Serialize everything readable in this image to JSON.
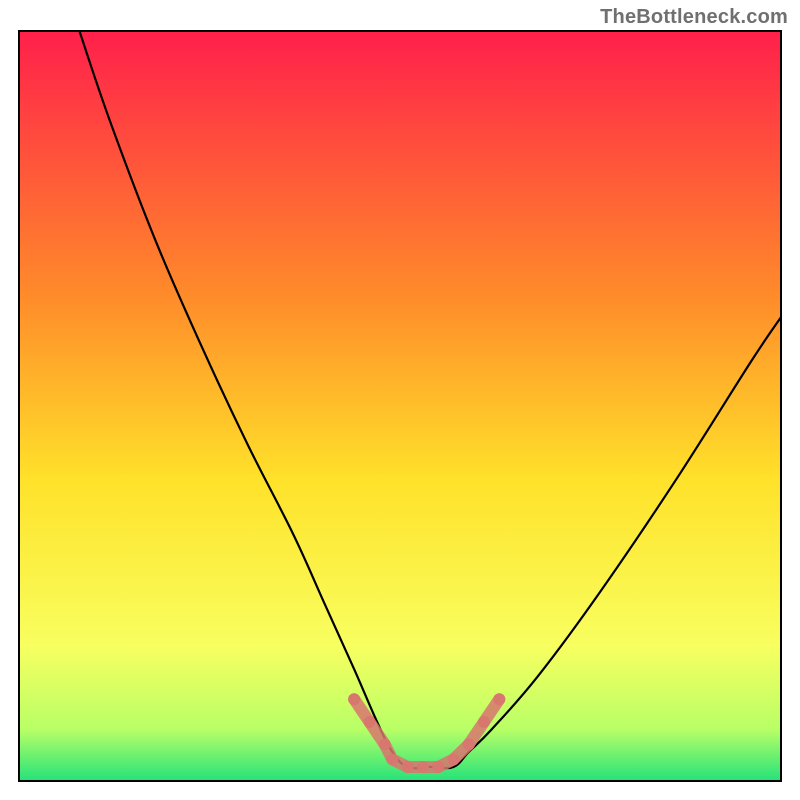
{
  "watermark": "TheBottleneck.com",
  "chart_data": {
    "type": "line",
    "title": "",
    "xlabel": "",
    "ylabel": "",
    "xlim": [
      0,
      100
    ],
    "ylim": [
      0,
      100
    ],
    "grid": false,
    "legend": false,
    "gradient_stops": [
      {
        "offset": 0.0,
        "color": "#ff1f4b"
      },
      {
        "offset": 0.35,
        "color": "#ff8a2a"
      },
      {
        "offset": 0.6,
        "color": "#ffe22a"
      },
      {
        "offset": 0.82,
        "color": "#f8ff60"
      },
      {
        "offset": 0.93,
        "color": "#b8ff66"
      },
      {
        "offset": 1.0,
        "color": "#22e27a"
      }
    ],
    "series": [
      {
        "name": "bottleneck-curve",
        "color": "#000000",
        "x": [
          8,
          12,
          18,
          24,
          30,
          36,
          40,
          44,
          47,
          49,
          51,
          54,
          57,
          59,
          62,
          68,
          76,
          86,
          96,
          100
        ],
        "y": [
          100,
          88,
          72,
          58,
          45,
          33,
          24,
          15,
          8,
          4,
          2,
          2,
          2,
          4,
          7,
          14,
          25,
          40,
          56,
          62
        ]
      }
    ],
    "markers": {
      "name": "highlight-band",
      "color": "#d8766f",
      "radius": 6,
      "points": [
        {
          "x": 44,
          "y": 11
        },
        {
          "x": 46,
          "y": 8
        },
        {
          "x": 48,
          "y": 5
        },
        {
          "x": 49,
          "y": 3
        },
        {
          "x": 51,
          "y": 2
        },
        {
          "x": 53,
          "y": 2
        },
        {
          "x": 55,
          "y": 2
        },
        {
          "x": 57,
          "y": 3
        },
        {
          "x": 59,
          "y": 5
        },
        {
          "x": 61,
          "y": 8
        },
        {
          "x": 63,
          "y": 11
        }
      ]
    }
  }
}
